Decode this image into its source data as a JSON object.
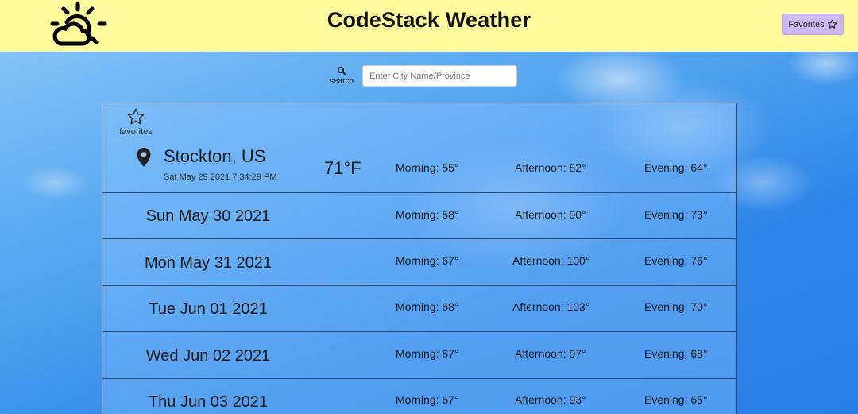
{
  "app": {
    "title": "CodeStack Weather",
    "favorites_label": "Favorites"
  },
  "search": {
    "label": "search",
    "placeholder": "Enter City Name/Province",
    "value": ""
  },
  "current": {
    "favorites_label": "favorites",
    "city": "Stockton, US",
    "datetime": "Sat May 29 2021 7:34:29 PM",
    "temperature": "71°F",
    "morning": "Morning: 55°",
    "afternoon": "Afternoon: 82°",
    "evening": "Evening: 64°"
  },
  "forecast": [
    {
      "date": "Sun May 30 2021",
      "morning": "Morning: 58°",
      "afternoon": "Afternoon: 90°",
      "evening": "Evening: 73°"
    },
    {
      "date": "Mon May 31 2021",
      "morning": "Morning: 67°",
      "afternoon": "Afternoon: 100°",
      "evening": "Evening: 76°"
    },
    {
      "date": "Tue Jun 01 2021",
      "morning": "Morning: 68°",
      "afternoon": "Afternoon: 103°",
      "evening": "Evening: 70°"
    },
    {
      "date": "Wed Jun 02 2021",
      "morning": "Morning: 67°",
      "afternoon": "Afternoon: 97°",
      "evening": "Evening: 68°"
    },
    {
      "date": "Thu Jun 03 2021",
      "morning": "Morning: 67°",
      "afternoon": "Afternoon: 93°",
      "evening": "Evening: 65°"
    }
  ],
  "colors": {
    "header_bg": "#fdfb9e",
    "favorites_button_bg": "#cdb8f2",
    "panel_border": "#3a4a66"
  },
  "icons": {
    "logo": "sun-cloud-icon",
    "favorites_button": "star-outline-icon",
    "search": "search-icon",
    "location": "map-pin-icon"
  }
}
